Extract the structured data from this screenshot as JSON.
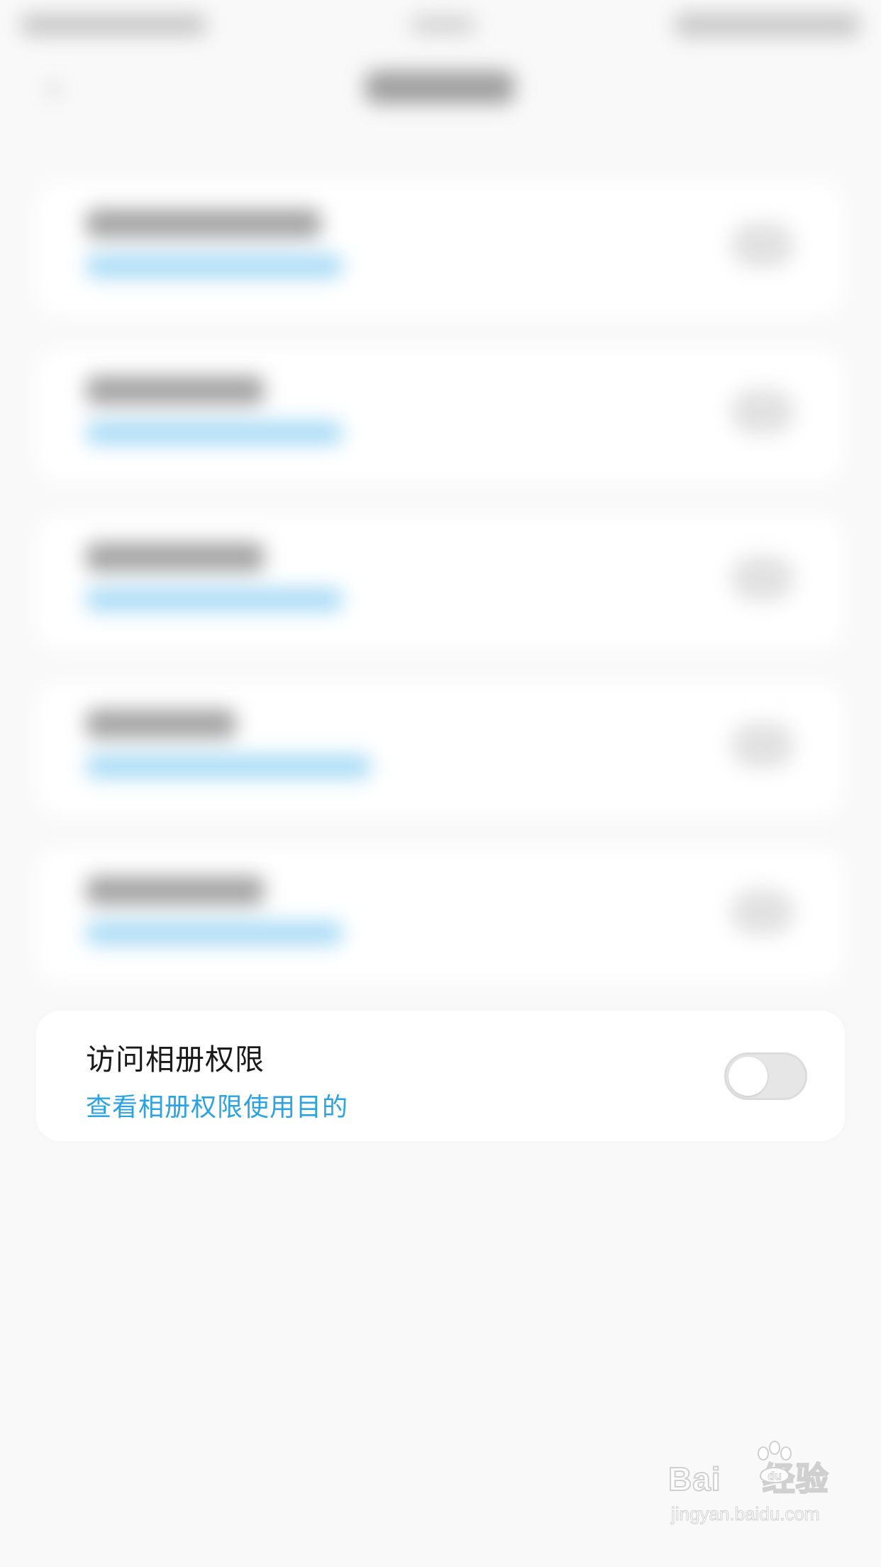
{
  "permission": {
    "title": "访问相册权限",
    "link": "查看相册权限使用目的",
    "enabled": false
  },
  "watermark": {
    "brand": "Bai",
    "brand_suffix": "经验",
    "url": "jingyan.baidu.com",
    "icon": "baidu-paw-icon"
  },
  "colors": {
    "link": "#2aa3e3",
    "title": "#1a1a1a",
    "card": "#ffffff",
    "background": "#f9f9f9",
    "toggle_off": "#e6e6e6"
  }
}
